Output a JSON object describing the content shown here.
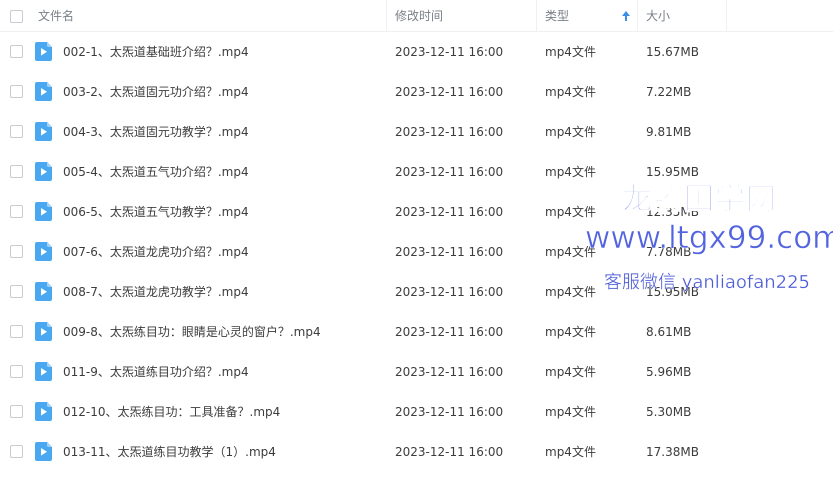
{
  "header": {
    "name": "文件名",
    "modified": "修改时间",
    "type": "类型",
    "size": "大小"
  },
  "rows": [
    {
      "name": "002-1、太炁道基础班介绍？.mp4",
      "modified": "2023-12-11 16:00",
      "type": "mp4文件",
      "size": "15.67MB"
    },
    {
      "name": "003-2、太炁道固元功介绍？.mp4",
      "modified": "2023-12-11 16:00",
      "type": "mp4文件",
      "size": "7.22MB"
    },
    {
      "name": "004-3、太炁道固元功教学？.mp4",
      "modified": "2023-12-11 16:00",
      "type": "mp4文件",
      "size": "9.81MB"
    },
    {
      "name": "005-4、太炁道五气功介绍？.mp4",
      "modified": "2023-12-11 16:00",
      "type": "mp4文件",
      "size": "15.95MB"
    },
    {
      "name": "006-5、太炁道五气功教学？.mp4",
      "modified": "2023-12-11 16:00",
      "type": "mp4文件",
      "size": "12.35MB"
    },
    {
      "name": "007-6、太炁道龙虎功介绍？.mp4",
      "modified": "2023-12-11 16:00",
      "type": "mp4文件",
      "size": "7.78MB"
    },
    {
      "name": "008-7、太炁道龙虎功教学？.mp4",
      "modified": "2023-12-11 16:00",
      "type": "mp4文件",
      "size": "15.95MB"
    },
    {
      "name": "009-8、太炁练目功：眼睛是心灵的窗户？.mp4",
      "modified": "2023-12-11 16:00",
      "type": "mp4文件",
      "size": "8.61MB"
    },
    {
      "name": "011-9、太炁道练目功介绍？.mp4",
      "modified": "2023-12-11 16:00",
      "type": "mp4文件",
      "size": "5.96MB"
    },
    {
      "name": "012-10、太炁练目功：工具准备？.mp4",
      "modified": "2023-12-11 16:00",
      "type": "mp4文件",
      "size": "5.30MB"
    },
    {
      "name": "013-11、太炁道练目功教学（1）.mp4",
      "modified": "2023-12-11 16:00",
      "type": "mp4文件",
      "size": "17.38MB"
    }
  ],
  "watermark": {
    "line1": "龙腾国学网",
    "line2": "www.ltgx99.com",
    "line3": "客服微信 yanliaofan225"
  },
  "colors": {
    "file_icon": "#4aa8f0",
    "sort_arrow": "#3a8ee6",
    "watermark": "#5263e0"
  },
  "icons": {
    "file": "video-file-icon",
    "sort": "sort-ascending-arrow-icon"
  }
}
